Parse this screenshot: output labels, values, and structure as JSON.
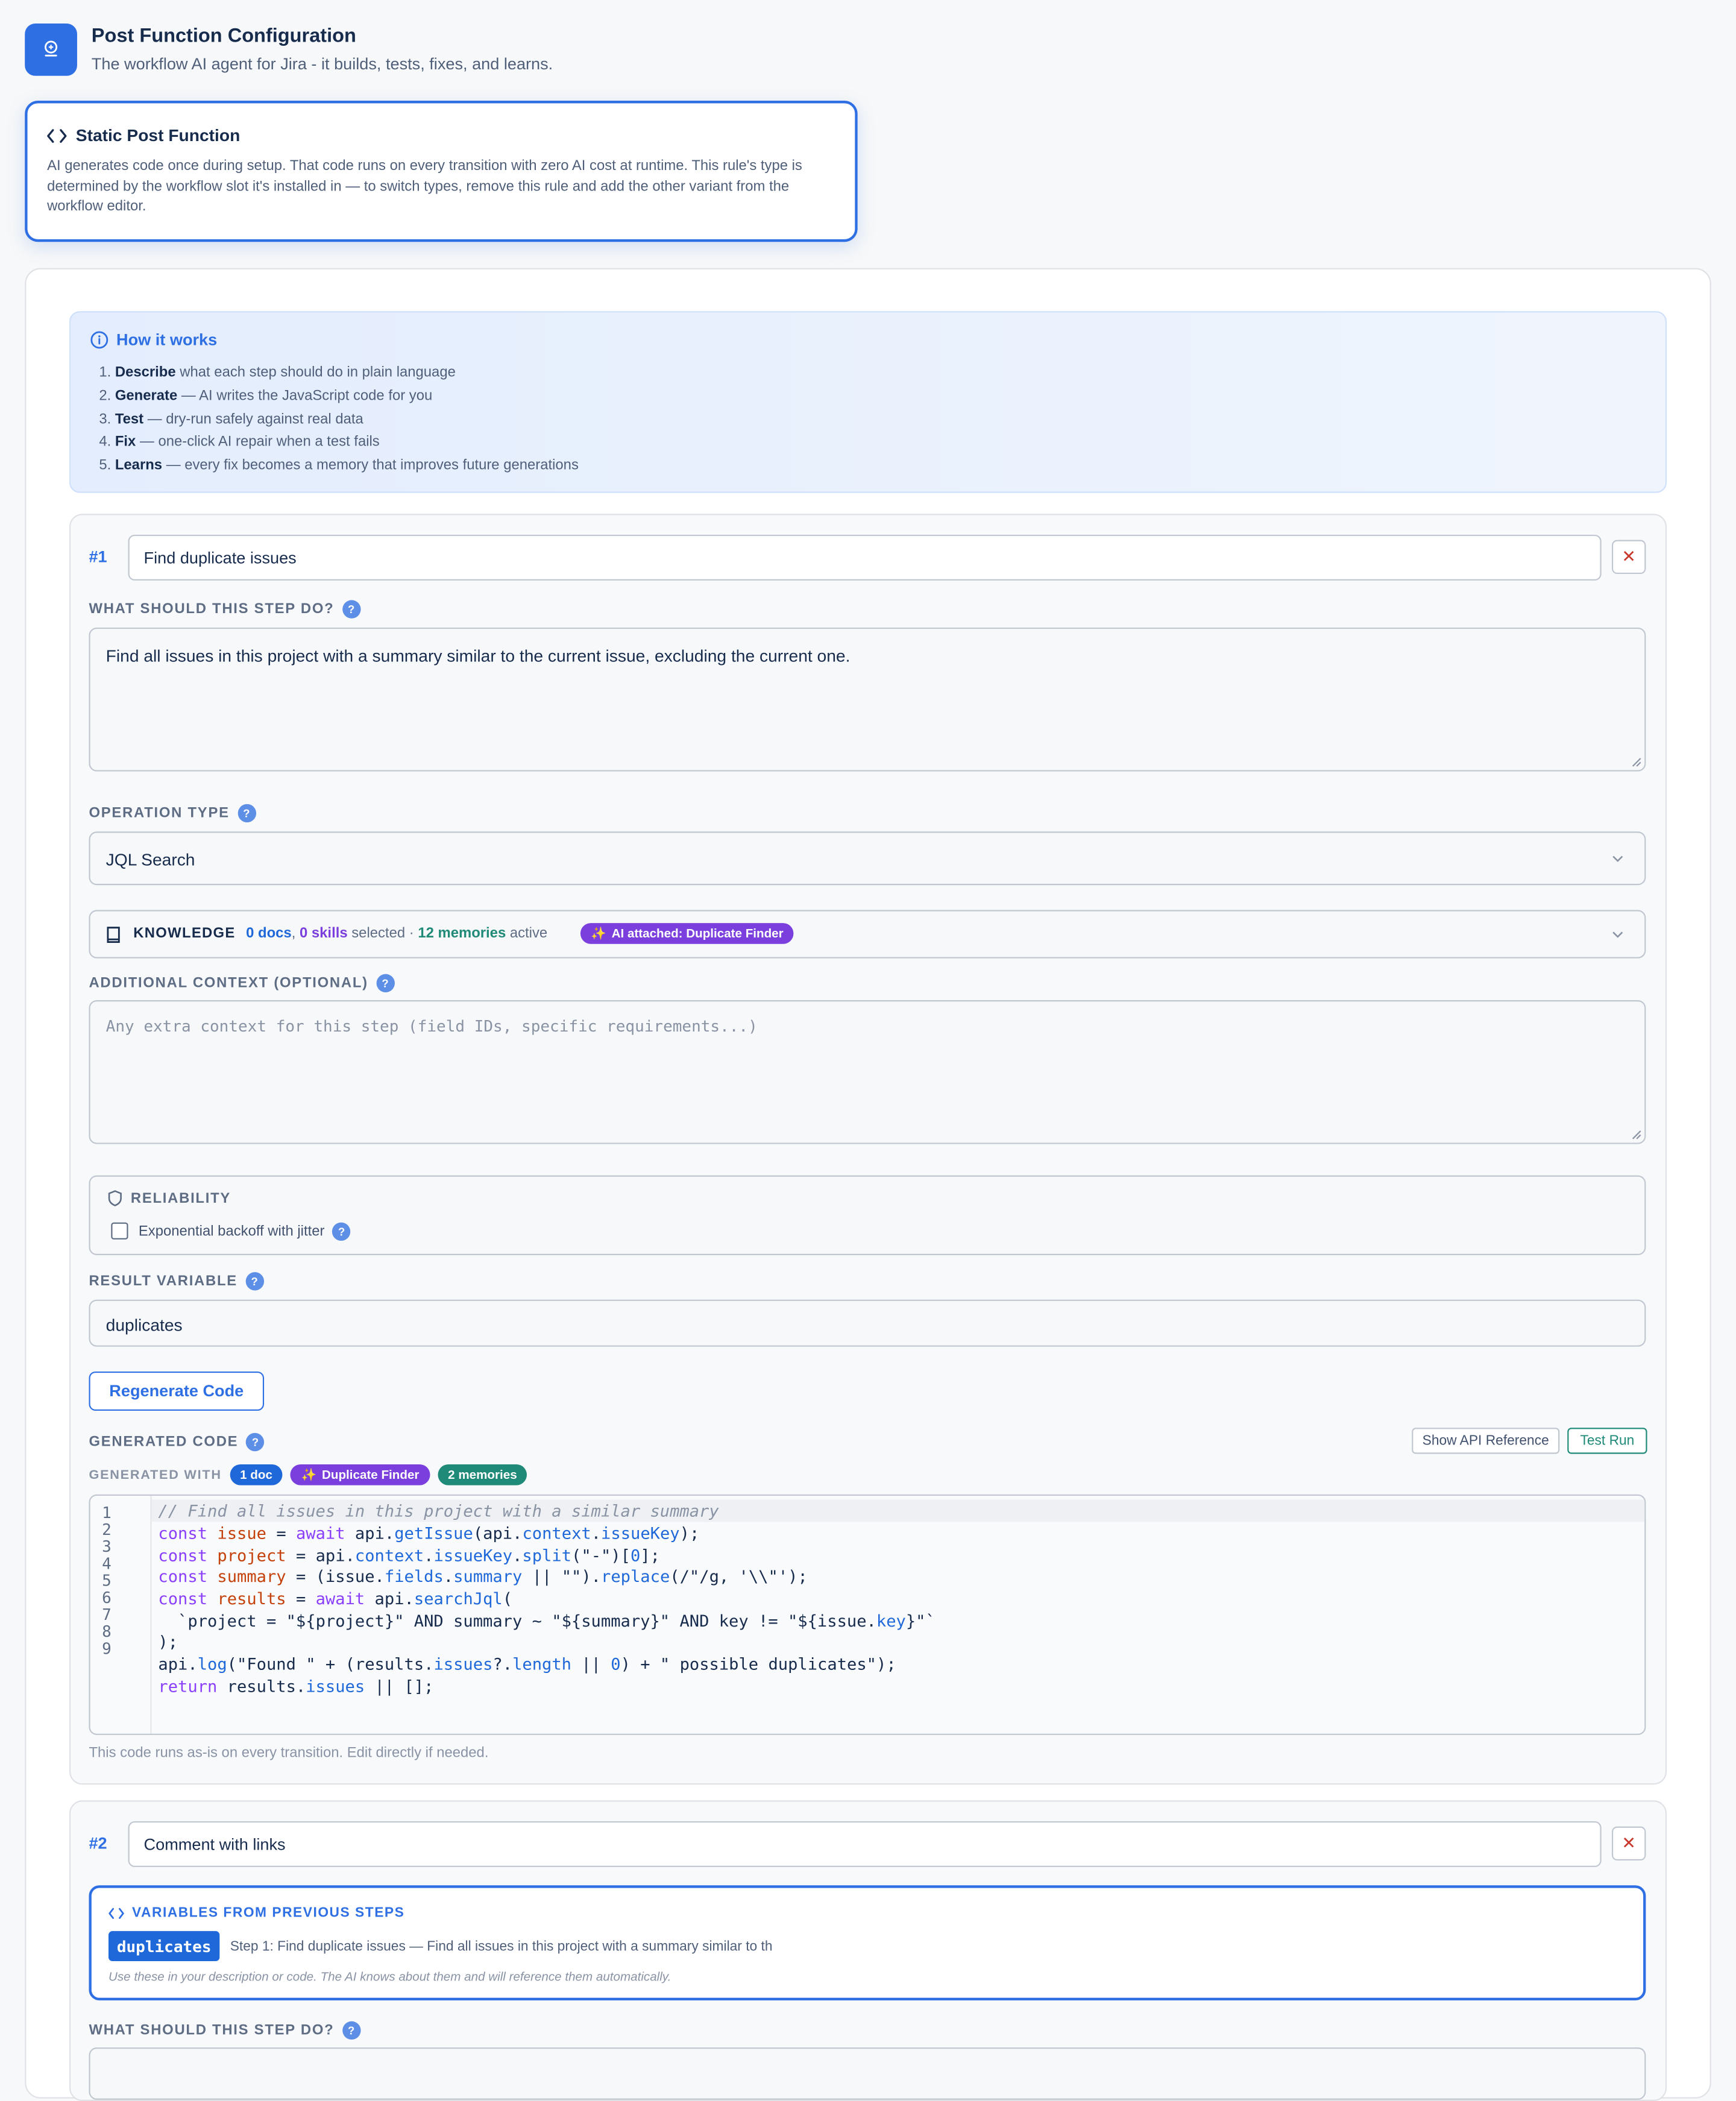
{
  "header": {
    "title": "Post Function Configuration",
    "subtitle": "The workflow AI agent for Jira - it builds, tests, fixes, and learns."
  },
  "type_card": {
    "title": "Static Post Function",
    "description": "AI generates code once during setup. That code runs on every transition with zero AI cost at runtime. This rule's type is determined by the workflow slot it's installed in — to switch types, remove this rule and add the other variant from the workflow editor."
  },
  "how_it_works": {
    "title": "How it works",
    "steps": [
      {
        "bold": "Describe",
        "text": " what each step should do in plain language"
      },
      {
        "bold": "Generate",
        "text": " — AI writes the JavaScript code for you"
      },
      {
        "bold": "Test",
        "text": " — dry-run safely against real data"
      },
      {
        "bold": "Fix",
        "text": " — one-click AI repair when a test fails"
      },
      {
        "bold": "Learns",
        "text": " — every fix becomes a memory that improves future generations"
      }
    ]
  },
  "step1": {
    "number": "#1",
    "name": "Find duplicate issues",
    "delete_label": "✕",
    "description_label": "WHAT SHOULD THIS STEP DO?",
    "description": "Find all issues in this project with a summary similar to the current issue, excluding the current one.",
    "operation_label": "OPERATION TYPE",
    "operation_value": "JQL Search",
    "knowledge": {
      "label": "KNOWLEDGE",
      "docs": "0 docs",
      "comma": ",",
      "skills": "0 skills",
      "selected": "selected ·",
      "memories": "12 memories",
      "active": "active",
      "ai_badge": "AI attached: Duplicate Finder"
    },
    "context_label": "ADDITIONAL CONTEXT (OPTIONAL)",
    "context_placeholder": "Any extra context for this step (field IDs, specific requirements...)",
    "reliability_label": "RELIABILITY",
    "backoff_label": "Exponential backoff with jitter",
    "result_label": "RESULT VARIABLE",
    "result_value": "duplicates",
    "regenerate_label": "Regenerate Code",
    "generated_code_label": "GENERATED CODE",
    "api_reference_label": "Show API Reference",
    "test_run_label": "Test Run",
    "generated_with_label": "GENERATED WITH",
    "badges": [
      "1 doc",
      "Duplicate Finder",
      "2 memories"
    ],
    "line_numbers": [
      "1",
      "2",
      "3",
      "4",
      "5",
      "6",
      "7",
      "8",
      "9"
    ],
    "code_footer": "This code runs as-is on every transition. Edit directly if needed."
  },
  "step2": {
    "number": "#2",
    "name": "Comment with links",
    "delete_label": "✕",
    "vars_title": "VARIABLES FROM PREVIOUS STEPS",
    "var_name": "duplicates",
    "var_desc": "Step 1: Find duplicate issues — Find all issues in this project with a summary similar to th",
    "vars_note": "Use these in your description or code. The AI knows about them and will reference them automatically.",
    "description_label": "WHAT SHOULD THIS STEP DO?"
  },
  "help_glyph": "?",
  "colors": {
    "accent": "#2f6fe4",
    "purple": "#7a3fdd",
    "green": "#1f8a77",
    "danger": "#c9372c"
  }
}
